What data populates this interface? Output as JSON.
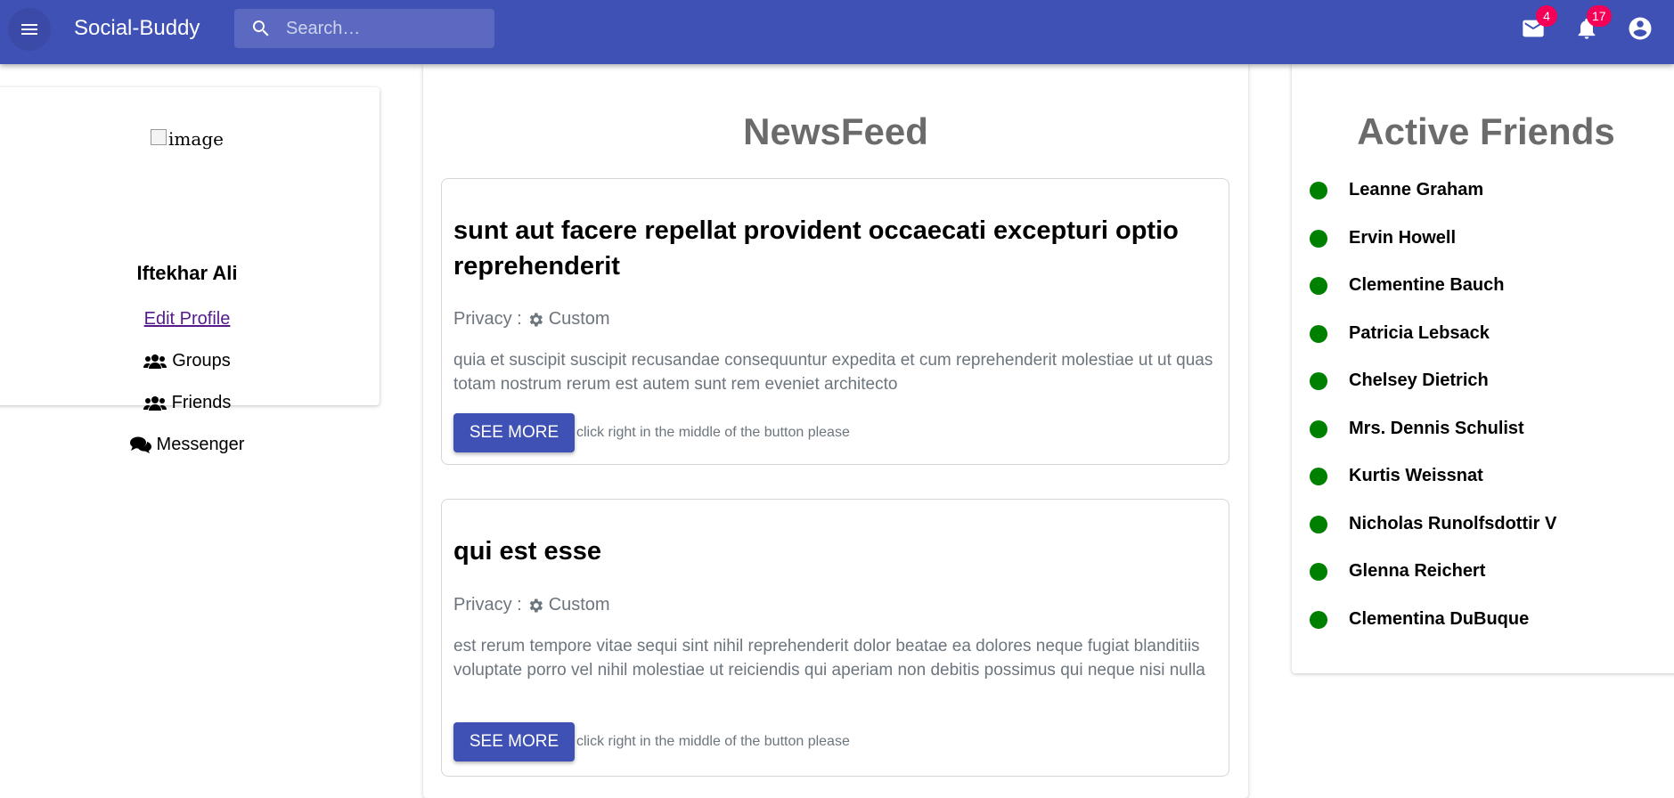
{
  "app": {
    "title": "Social-Buddy",
    "search_placeholder": "Search…",
    "mail_count": "4",
    "notification_count": "17",
    "primary_color": "#3f51b5",
    "badge_color": "#f50057"
  },
  "profile": {
    "image_alt": "image",
    "name": "Iftekhar Ali",
    "edit_link": "Edit Profile",
    "menu": [
      {
        "label": "Groups",
        "icon": "users-icon"
      },
      {
        "label": "Friends",
        "icon": "users-icon"
      },
      {
        "label": "Messenger",
        "icon": "comments-icon"
      }
    ]
  },
  "feed": {
    "title": "NewsFeed",
    "posts": [
      {
        "title": "sunt aut facere repellat provident occaecati excepturi optio reprehenderit",
        "privacy_label": "Privacy :",
        "privacy_value": "Custom",
        "body": "quia et suscipit suscipit recusandae consequuntur expedita et cum reprehenderit molestiae ut ut quas totam nostrum rerum est autem sunt rem eveniet architecto",
        "button": "SEE MORE",
        "hint": "click right in the middle of the button please"
      },
      {
        "title": "qui est esse",
        "privacy_label": "Privacy :",
        "privacy_value": "Custom",
        "body": "est rerum tempore vitae sequi sint nihil reprehenderit dolor beatae ea dolores neque fugiat blanditiis voluptate porro vel nihil molestiae ut reiciendis qui aperiam non debitis possimus qui neque nisi nulla",
        "button": "SEE MORE",
        "hint": "click right in the middle of the button please"
      }
    ]
  },
  "friends": {
    "title": "Active Friends",
    "status_color": "#008000",
    "list": [
      "Leanne Graham",
      "Ervin Howell",
      "Clementine Bauch",
      "Patricia Lebsack",
      "Chelsey Dietrich",
      "Mrs. Dennis Schulist",
      "Kurtis Weissnat",
      "Nicholas Runolfsdottir V",
      "Glenna Reichert",
      "Clementina DuBuque"
    ]
  }
}
